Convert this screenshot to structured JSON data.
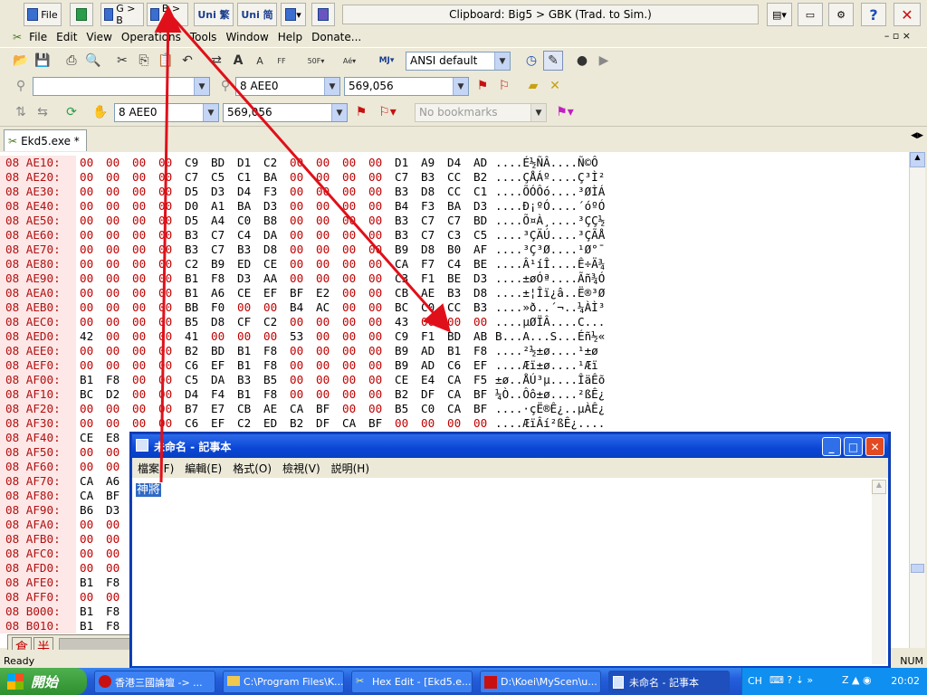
{
  "top_toolbar": {
    "file_label": "File",
    "g2b_label": "G > B",
    "b2g_label": "B > G",
    "uni_trad_label": "Uni 繁",
    "uni_simp_label": "Uni 简",
    "clipboard_status": "Clipboard: Big5 > GBK (Trad. to Sim.)"
  },
  "menu": {
    "items": [
      "File",
      "Edit",
      "View",
      "Operations",
      "Tools",
      "Window",
      "Help",
      "Donate..."
    ]
  },
  "toolbar": {
    "encoding": "ANSI default",
    "search_value": "",
    "find_value": "8 AEE0",
    "find_decimal": "569,056",
    "goto_value": "8 AEE0",
    "goto_decimal": "569,056",
    "bookmarks_placeholder": "No bookmarks"
  },
  "document_tab": {
    "label": "Ekd5.exe *"
  },
  "hex_rows": [
    {
      "off": "08 AE10:",
      "b": [
        "00",
        "00",
        "00",
        "00",
        "C9",
        "BD",
        "D1",
        "C2",
        "00",
        "00",
        "00",
        "00",
        "D1",
        "A9",
        "D4",
        "AD"
      ],
      "ascii": "....É½ÑÂ....Ñ©Ô­"
    },
    {
      "off": "08 AE20:",
      "b": [
        "00",
        "00",
        "00",
        "00",
        "C7",
        "C5",
        "C1",
        "BA",
        "00",
        "00",
        "00",
        "00",
        "C7",
        "B3",
        "CC",
        "B2"
      ],
      "ascii": "....ÇÅÁº....Ç³Ì²"
    },
    {
      "off": "08 AE30:",
      "b": [
        "00",
        "00",
        "00",
        "00",
        "D5",
        "D3",
        "D4",
        "F3",
        "00",
        "00",
        "00",
        "00",
        "B3",
        "D8",
        "CC",
        "C1"
      ],
      "ascii": "....ÕÓÔó....³ØÌÁ"
    },
    {
      "off": "08 AE40:",
      "b": [
        "00",
        "00",
        "00",
        "00",
        "D0",
        "A1",
        "BA",
        "D3",
        "00",
        "00",
        "00",
        "00",
        "B4",
        "F3",
        "BA",
        "D3"
      ],
      "ascii": "....Ð¡ºÓ....´óºÓ"
    },
    {
      "off": "08 AE50:",
      "b": [
        "00",
        "00",
        "00",
        "00",
        "D5",
        "A4",
        "C0",
        "B8",
        "00",
        "00",
        "00",
        "00",
        "B3",
        "C7",
        "C7",
        "BD"
      ],
      "ascii": "....Õ¤À¸....³ÇÇ½"
    },
    {
      "off": "08 AE60:",
      "b": [
        "00",
        "00",
        "00",
        "00",
        "B3",
        "C7",
        "C4",
        "DA",
        "00",
        "00",
        "00",
        "00",
        "B3",
        "C7",
        "C3",
        "C5"
      ],
      "ascii": "....³ÇÄÚ....³ÇÃÅ"
    },
    {
      "off": "08 AE70:",
      "b": [
        "00",
        "00",
        "00",
        "00",
        "B3",
        "C7",
        "B3",
        "D8",
        "00",
        "00",
        "00",
        "00",
        "B9",
        "D8",
        "B0",
        "AF"
      ],
      "ascii": "....³Ç³Ø....¹Ø°¯"
    },
    {
      "off": "08 AE80:",
      "b": [
        "00",
        "00",
        "00",
        "00",
        "C2",
        "B9",
        "ED",
        "CE",
        "00",
        "00",
        "00",
        "00",
        "CA",
        "F7",
        "C4",
        "BE"
      ],
      "ascii": "....Â¹íÎ....Ê÷Ä¾"
    },
    {
      "off": "08 AE90:",
      "b": [
        "00",
        "00",
        "00",
        "00",
        "B1",
        "F8",
        "D3",
        "AA",
        "00",
        "00",
        "00",
        "00",
        "C3",
        "F1",
        "BE",
        "D3"
      ],
      "ascii": "....±øÓª....Ãñ¾Ó"
    },
    {
      "off": "08 AEA0:",
      "b": [
        "00",
        "00",
        "00",
        "00",
        "B1",
        "A6",
        "CE",
        "EF",
        "BF",
        "E2",
        "00",
        "00",
        "CB",
        "AE",
        "B3",
        "D8"
      ],
      "ascii": "....±¦Îï¿â..Ë®³Ø"
    },
    {
      "off": "08 AEB0:",
      "b": [
        "00",
        "00",
        "00",
        "00",
        "BB",
        "F0",
        "00",
        "00",
        "B4",
        "AC",
        "00",
        "00",
        "BC",
        "C0",
        "CC",
        "B3"
      ],
      "ascii": "....»ð..´¬..¼ÀÌ³"
    },
    {
      "off": "08 AEC0:",
      "b": [
        "00",
        "00",
        "00",
        "00",
        "B5",
        "D8",
        "CF",
        "C2",
        "00",
        "00",
        "00",
        "00",
        "43",
        "00",
        "00",
        "00"
      ],
      "ascii": "....µØÏÂ....C..."
    },
    {
      "off": "08 AED0:",
      "b": [
        "42",
        "00",
        "00",
        "00",
        "41",
        "00",
        "00",
        "00",
        "53",
        "00",
        "00",
        "00",
        "C9",
        "F1",
        "BD",
        "AB"
      ],
      "ascii": "B...A...S...Éñ½«"
    },
    {
      "off": "08 AEE0:",
      "b": [
        "00",
        "00",
        "00",
        "00",
        "B2",
        "BD",
        "B1",
        "F8",
        "00",
        "00",
        "00",
        "00",
        "B9",
        "AD",
        "B1",
        "F8"
      ],
      "ascii": "....²½±ø....¹­±ø"
    },
    {
      "off": "08 AEF0:",
      "b": [
        "00",
        "00",
        "00",
        "00",
        "C6",
        "EF",
        "B1",
        "F8",
        "00",
        "00",
        "00",
        "00",
        "B9",
        "AD",
        "C6",
        "EF"
      ],
      "ascii": "....Æï±ø....¹­Æï"
    },
    {
      "off": "08 AF00:",
      "b": [
        "B1",
        "F8",
        "00",
        "00",
        "C5",
        "DA",
        "B3",
        "B5",
        "00",
        "00",
        "00",
        "00",
        "CE",
        "E4",
        "CA",
        "F5"
      ],
      "ascii": "±ø..ÅÚ³µ....ÎäÊõ"
    },
    {
      "off": "08 AF10:",
      "b": [
        "BC",
        "D2",
        "00",
        "00",
        "D4",
        "F4",
        "B1",
        "F8",
        "00",
        "00",
        "00",
        "00",
        "B2",
        "DF",
        "CA",
        "BF"
      ],
      "ascii": "¼Ò..Ôô±ø....²ßÊ¿"
    },
    {
      "off": "08 AF20:",
      "b": [
        "00",
        "00",
        "00",
        "00",
        "B7",
        "E7",
        "CB",
        "AE",
        "CA",
        "BF",
        "00",
        "00",
        "B5",
        "C0",
        "CA",
        "BF"
      ],
      "ascii": "....·çË®Ê¿..µÀÊ¿"
    },
    {
      "off": "08 AF30:",
      "b": [
        "00",
        "00",
        "00",
        "00",
        "C6",
        "EF",
        "C2",
        "ED",
        "B2",
        "DF",
        "CA",
        "BF",
        "00",
        "00",
        "00",
        "00"
      ],
      "ascii": "....ÆïÂí²ßÊ¿...."
    },
    {
      "off": "08 AF40:",
      "b": [
        "CE",
        "E8"
      ],
      "ascii": ""
    },
    {
      "off": "08 AF50:",
      "b": [
        "00",
        "00"
      ],
      "ascii": ""
    },
    {
      "off": "08 AF60:",
      "b": [
        "00",
        "00"
      ],
      "ascii": ""
    },
    {
      "off": "08 AF70:",
      "b": [
        "CA",
        "A6"
      ],
      "ascii": ""
    },
    {
      "off": "08 AF80:",
      "b": [
        "CA",
        "BF"
      ],
      "ascii": ""
    },
    {
      "off": "08 AF90:",
      "b": [
        "B6",
        "D3"
      ],
      "ascii": ""
    },
    {
      "off": "08 AFA0:",
      "b": [
        "00",
        "00"
      ],
      "ascii": ""
    },
    {
      "off": "08 AFB0:",
      "b": [
        "00",
        "00"
      ],
      "ascii": ""
    },
    {
      "off": "08 AFC0:",
      "b": [
        "00",
        "00"
      ],
      "ascii": ""
    },
    {
      "off": "08 AFD0:",
      "b": [
        "00",
        "00"
      ],
      "ascii": ""
    },
    {
      "off": "08 AFE0:",
      "b": [
        "B1",
        "F8"
      ],
      "ascii": ""
    },
    {
      "off": "08 AFF0:",
      "b": [
        "00",
        "00"
      ],
      "ascii": ""
    },
    {
      "off": "08 B000:",
      "b": [
        "B1",
        "F8"
      ],
      "ascii": ""
    },
    {
      "off": "08 B010:",
      "b": [
        "B1",
        "F8"
      ],
      "ascii": ""
    }
  ],
  "ime_bar": {
    "mode1": "倉",
    "mode2": "半"
  },
  "status": {
    "left": "Ready",
    "right": "NUM"
  },
  "notepad": {
    "title": "未命名 - 記事本",
    "menu": [
      "檔案(F)",
      "編輯(E)",
      "格式(O)",
      "檢視(V)",
      "説明(H)"
    ],
    "content": "神將"
  },
  "taskbar": {
    "start_label": "開始",
    "items": [
      "香港三國論壇 -> ...",
      "C:\\Program Files\\K...",
      "Hex Edit - [Ekd5.e...",
      "D:\\Koei\\MyScen\\u...",
      "未命名 - 記事本"
    ],
    "lang": "CH",
    "clock": "20:02"
  },
  "colors": {
    "annotation_arrow": "#e0101a",
    "offset_text": "#b01010",
    "offset_bg": "#fde7e7",
    "selection": "#316ac5"
  }
}
